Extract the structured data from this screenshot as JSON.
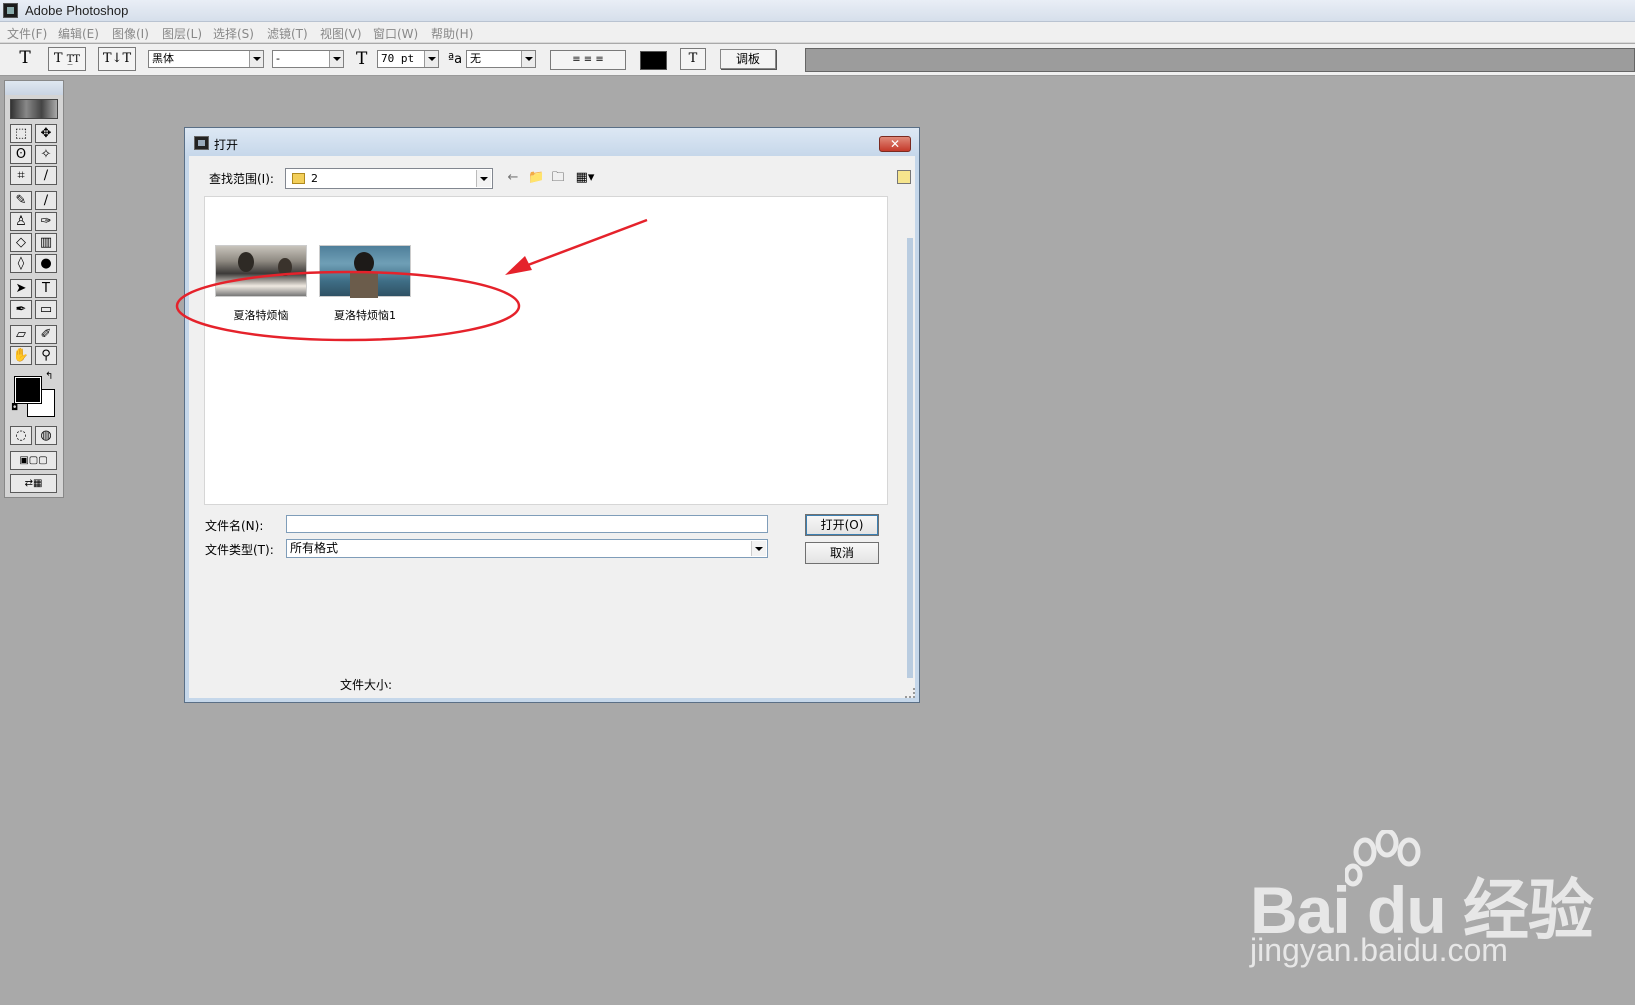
{
  "app": {
    "title": "Adobe Photoshop"
  },
  "menubar": {
    "items": [
      "文件(F)",
      "编辑(E)",
      "图像(I)",
      "图层(L)",
      "选择(S)",
      "滤镜(T)",
      "视图(V)",
      "窗口(W)",
      "帮助(H)"
    ]
  },
  "options": {
    "font_family": "黑体",
    "font_style": "-",
    "font_size": "70 pt",
    "antialias_label": "ªa",
    "antialias": "无",
    "palettes_button": "调板"
  },
  "dialog": {
    "title": "打开",
    "close_label": "✕",
    "look_in_label": "查找范围(I):",
    "look_in_value": "2",
    "files": [
      {
        "name": "夏洛特烦恼"
      },
      {
        "name": "夏洛特烦恼1"
      }
    ],
    "filename_label": "文件名(N):",
    "filename_value": "",
    "filetype_label": "文件类型(T):",
    "filetype_value": "所有格式",
    "open_button": "打开(O)",
    "cancel_button": "取消",
    "filesize_label": "文件大小:"
  },
  "annotation": {
    "color": "#e5222b"
  },
  "watermark": {
    "brand": "Bai du 经验",
    "url": "jingyan.baidu.com"
  }
}
